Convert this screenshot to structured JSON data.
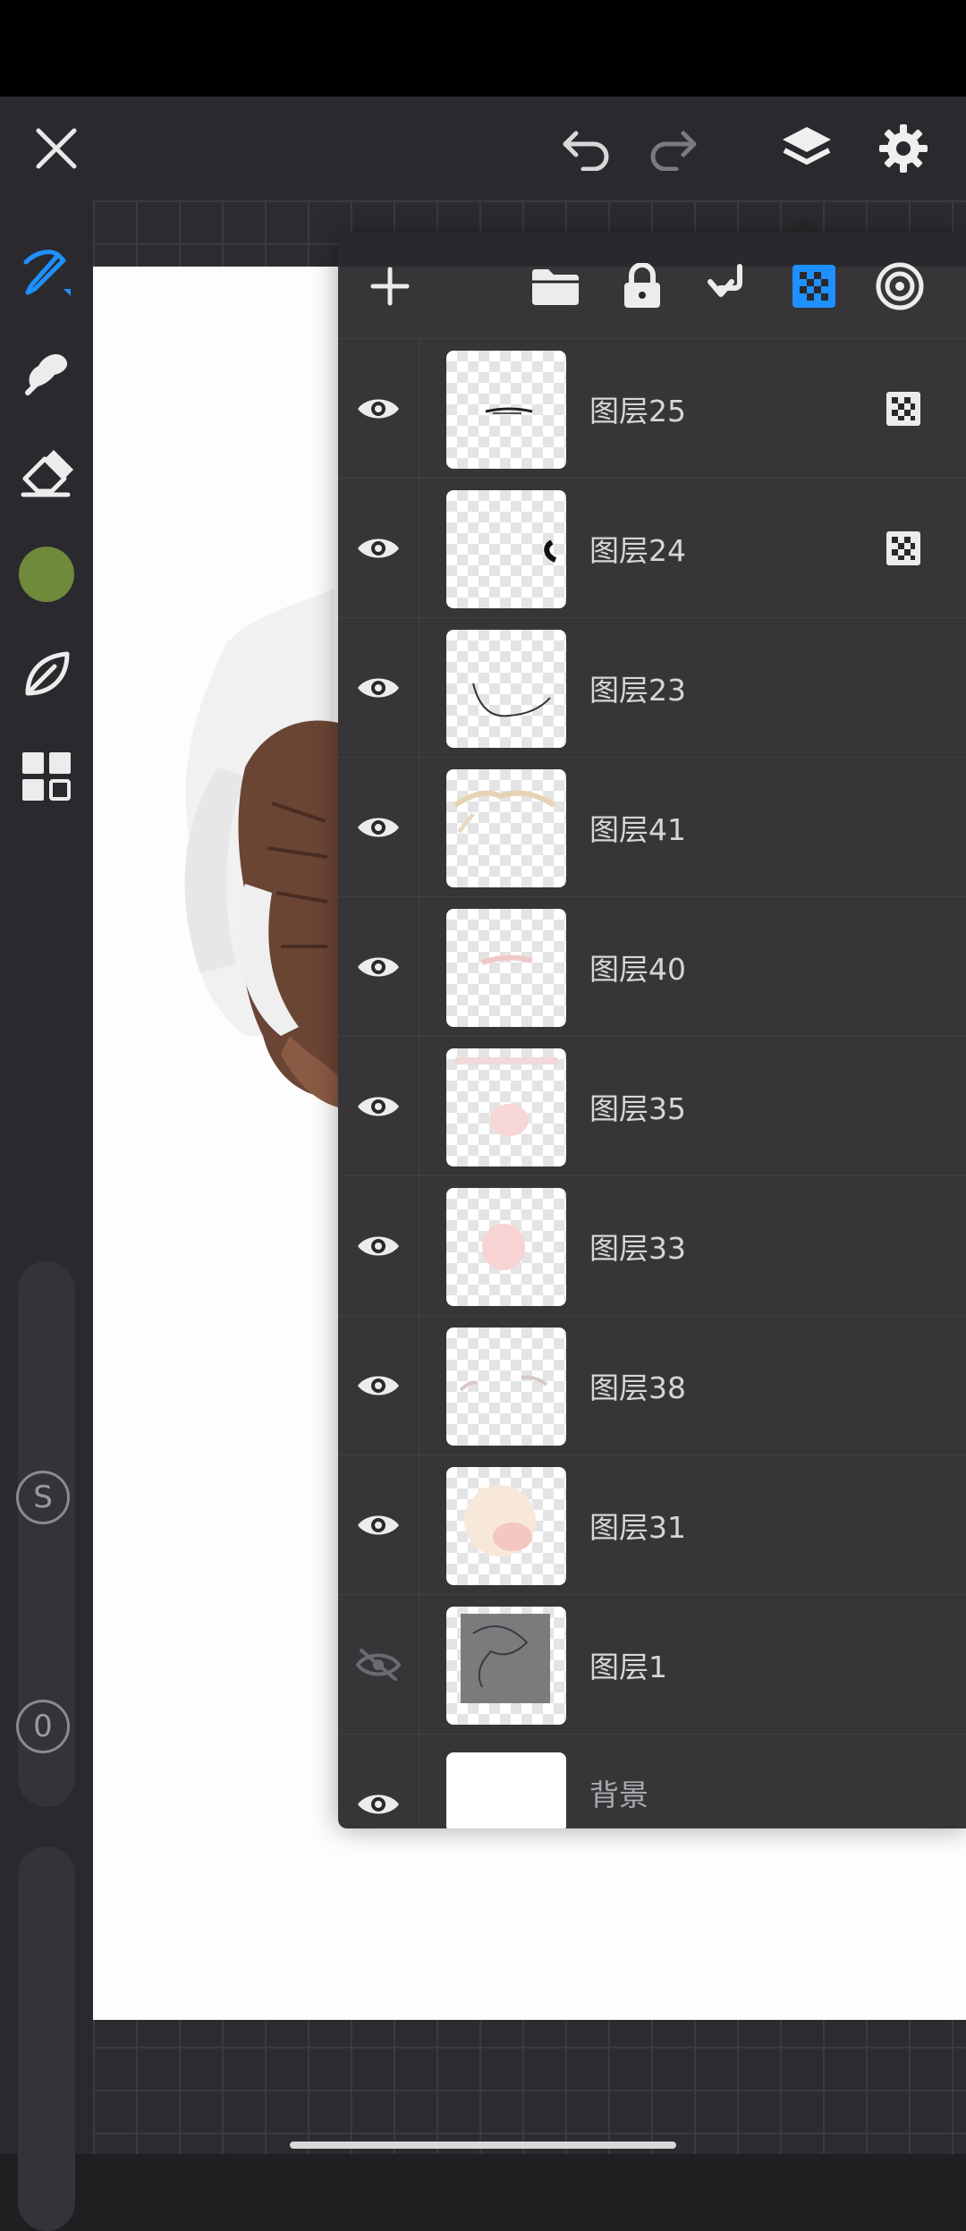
{
  "topbar": {
    "close_icon": "close-icon",
    "undo_icon": "undo-icon",
    "redo_icon": "redo-icon",
    "layers_icon": "layers-icon",
    "settings_icon": "gear-icon"
  },
  "left_tools": {
    "items": [
      "brush-icon",
      "smudge-icon",
      "eraser-icon",
      "color-swatch",
      "leaf-icon",
      "grid-icon"
    ],
    "current_color": "#6f8a3a",
    "size_slider_label": "S",
    "opacity_slider_label": "0"
  },
  "layers_panel": {
    "toolbar": [
      "add-icon",
      "folder-icon",
      "lock-icon",
      "merge-down-icon",
      "alpha-lock-icon",
      "blend-mode-icon"
    ],
    "active_accent": "#1e90ff",
    "layers": [
      {
        "name": "图层25",
        "visible": true,
        "alpha_locked": true
      },
      {
        "name": "图层24",
        "visible": true,
        "alpha_locked": true
      },
      {
        "name": "图层23",
        "visible": true,
        "alpha_locked": false
      },
      {
        "name": "图层41",
        "visible": true,
        "alpha_locked": false
      },
      {
        "name": "图层40",
        "visible": true,
        "alpha_locked": false
      },
      {
        "name": "图层35",
        "visible": true,
        "alpha_locked": false
      },
      {
        "name": "图层33",
        "visible": true,
        "alpha_locked": false
      },
      {
        "name": "图层38",
        "visible": true,
        "alpha_locked": false
      },
      {
        "name": "图层31",
        "visible": true,
        "alpha_locked": false
      },
      {
        "name": "图层1",
        "visible": false,
        "alpha_locked": false
      },
      {
        "name": "背景",
        "visible": true,
        "alpha_locked": false
      }
    ]
  }
}
